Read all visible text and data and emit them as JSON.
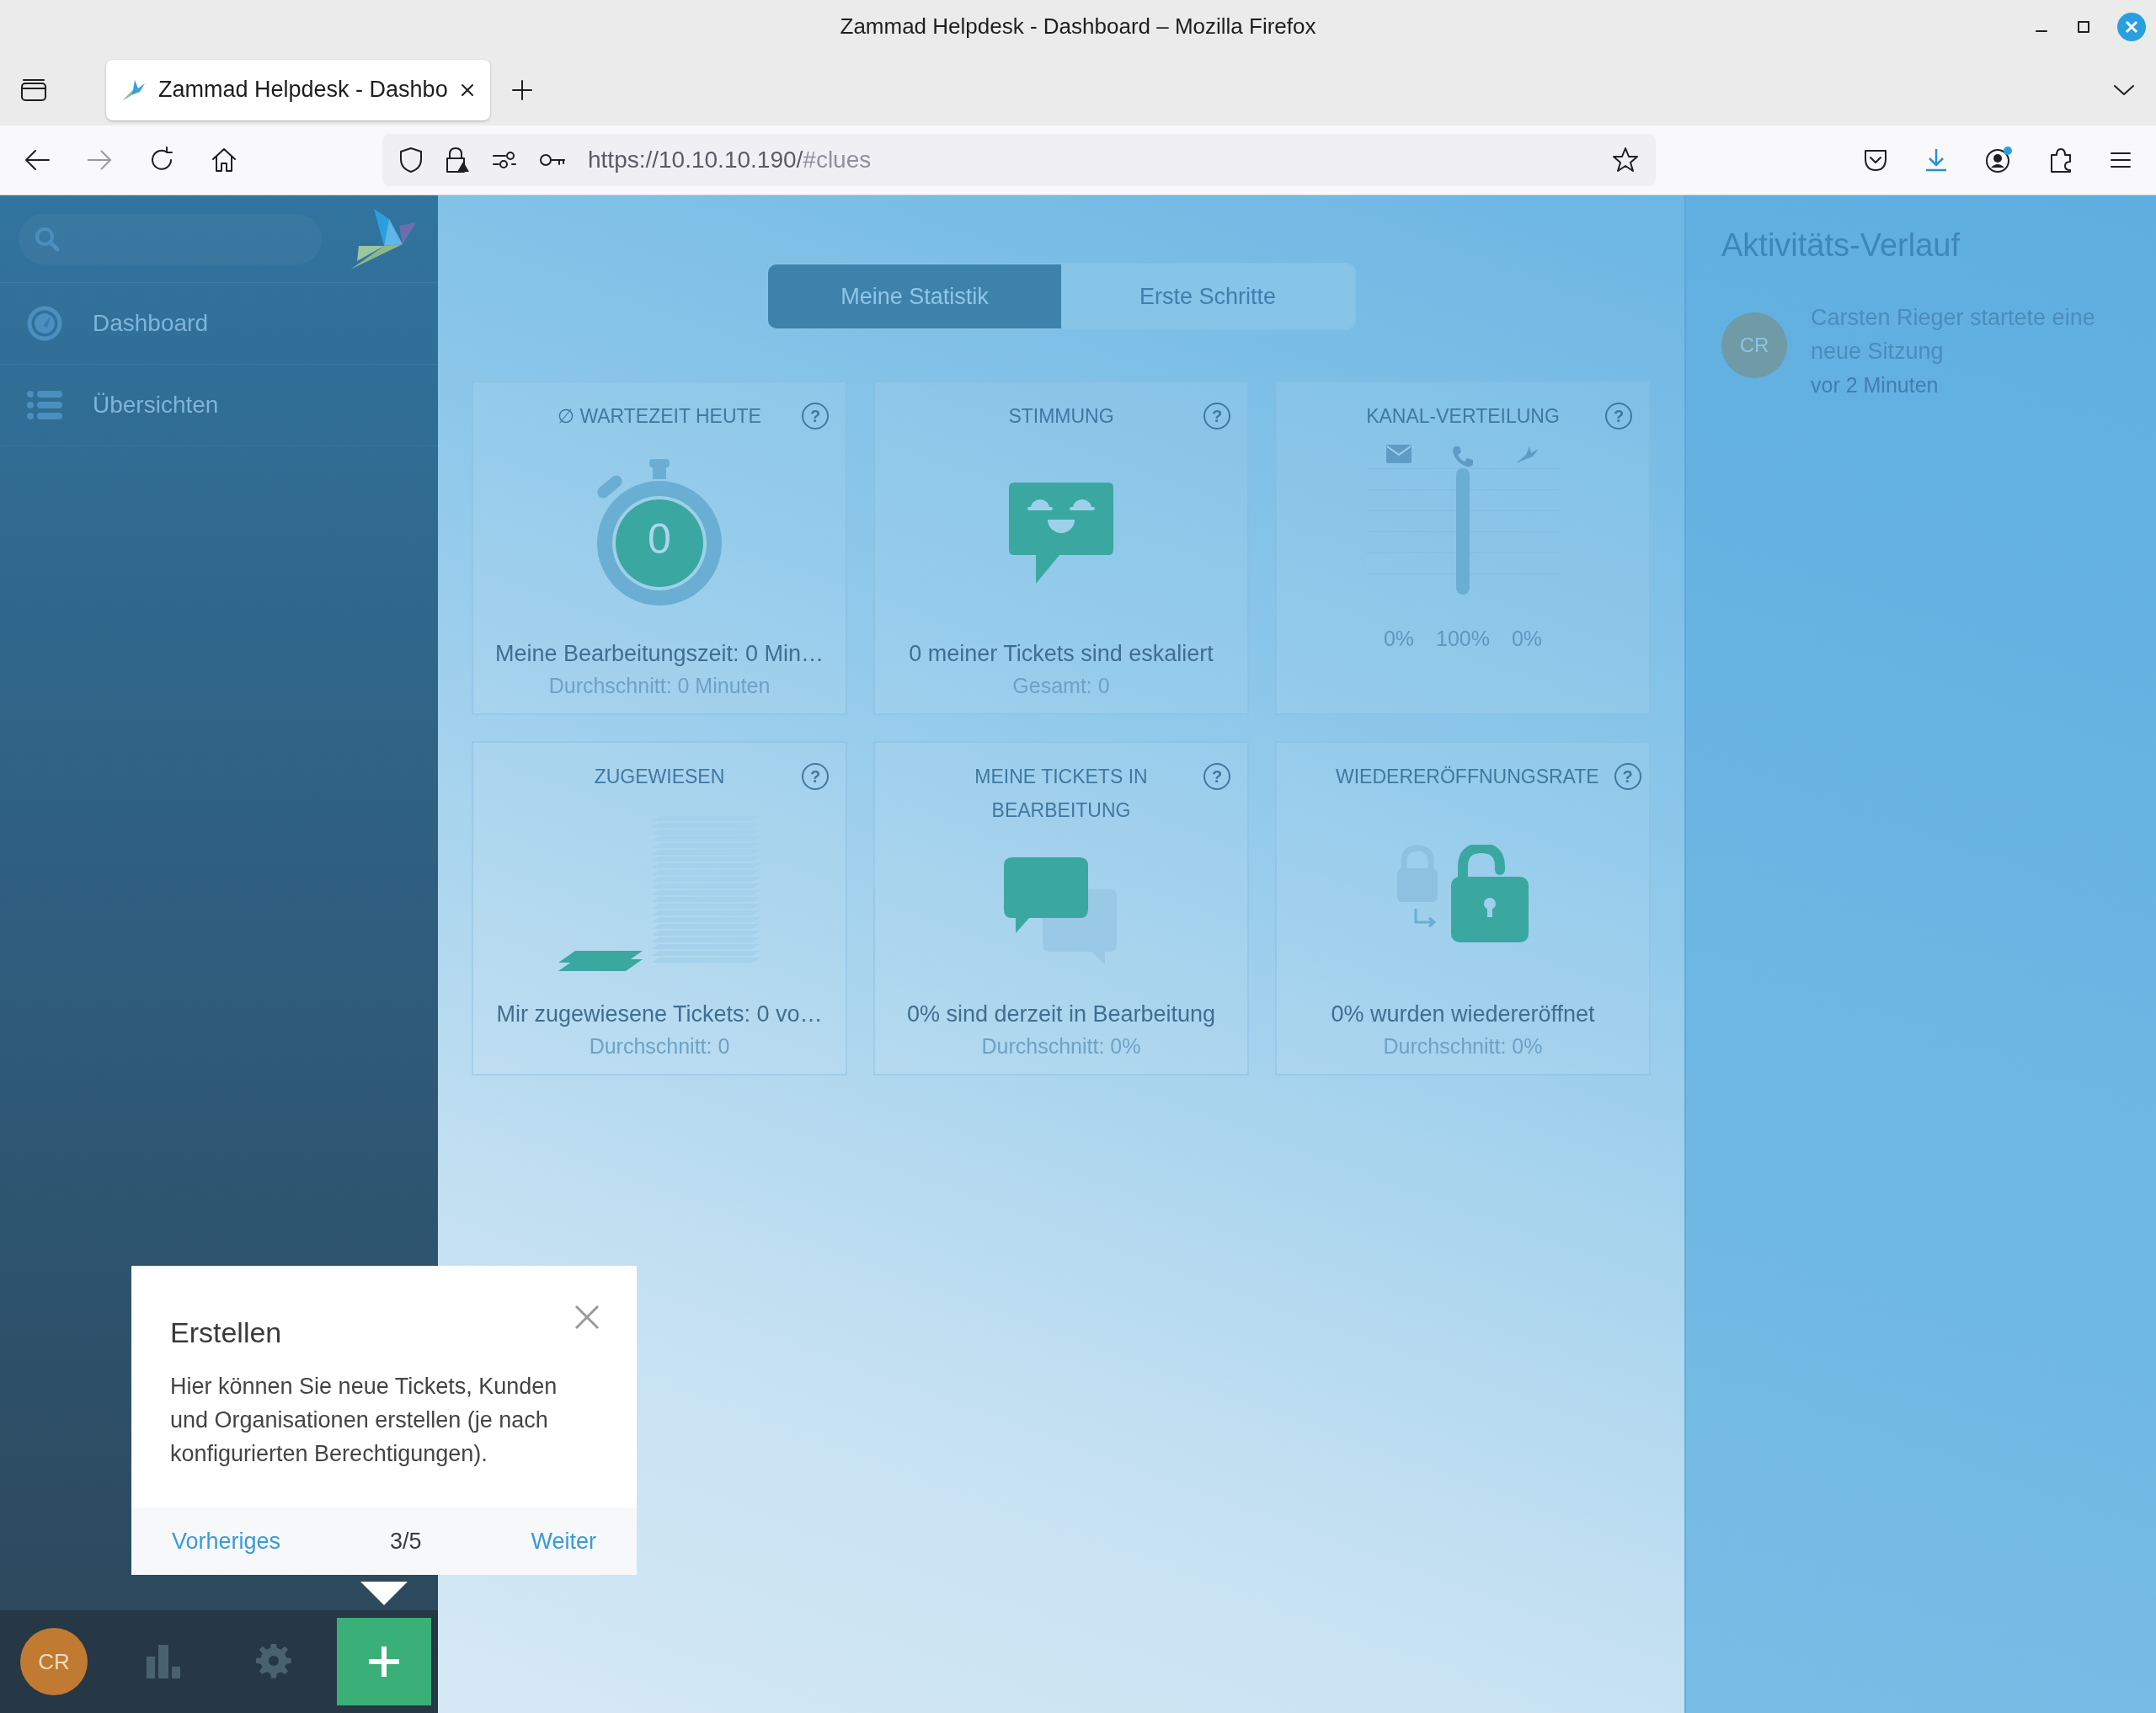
{
  "browser": {
    "window_title": "Zammad Helpdesk - Dashboard – Mozilla Firefox",
    "tab_title": "Zammad Helpdesk - Dashbo",
    "url": {
      "main": "https://10.10.10.190/",
      "rest": "#clues"
    }
  },
  "sidebar": {
    "nav": [
      {
        "label": "Dashboard",
        "selected": false
      },
      {
        "label": "Übersichten",
        "selected": false
      }
    ],
    "user_initials": "CR"
  },
  "dashboard_tabs": [
    {
      "label": "Meine Statistik",
      "selected": true
    },
    {
      "label": "Erste Schritte",
      "selected": false
    }
  ],
  "cards": [
    {
      "kind": "stopwatch",
      "title": "∅ WARTEZEIT HEUTE",
      "help": "?",
      "value": "0",
      "main": "Meine Bearbeitungszeit: 0 Min…",
      "sub": "Durchschnitt: 0 Minuten"
    },
    {
      "kind": "mood",
      "title": "STIMMUNG",
      "help": "?",
      "main": "0 meiner Tickets sind eskaliert",
      "sub": "Gesamt: 0"
    },
    {
      "kind": "channels",
      "title": "KANAL-VERTEILUNG",
      "help": "?",
      "readings": [
        "0%",
        "100%",
        "0%"
      ]
    },
    {
      "kind": "stack",
      "title": "ZUGEWIESEN",
      "help": "?",
      "main": "Mir zugewiesene Tickets: 0 vo…",
      "sub": "Durchschnitt: 0"
    },
    {
      "kind": "bubbles",
      "title": "MEINE TICKETS IN BEARBEITUNG",
      "help": "?",
      "main": "0% sind derzeit in Bearbeitung",
      "sub": "Durchschnitt: 0%"
    },
    {
      "kind": "locks",
      "title": "WIEDERERÖFFNUNGSRATE",
      "help": "?",
      "main": "0% wurden wiedereröffnet",
      "sub": "Durchschnitt: 0%"
    }
  ],
  "activity": {
    "title": "Aktivitäts-Verlauf",
    "items": [
      {
        "initials": "CR",
        "text": "Carsten Rieger startete eine neue Sitzung",
        "time": "vor 2 Minuten"
      }
    ]
  },
  "popover": {
    "title": "Erstellen",
    "body": "Hier können Sie neue Tickets, Kunden und Organisationen erstellen (je nach konfigurierten Berechtigungen).",
    "previous": "Vorheriges",
    "counter": "3/5",
    "next": "Weiter"
  }
}
